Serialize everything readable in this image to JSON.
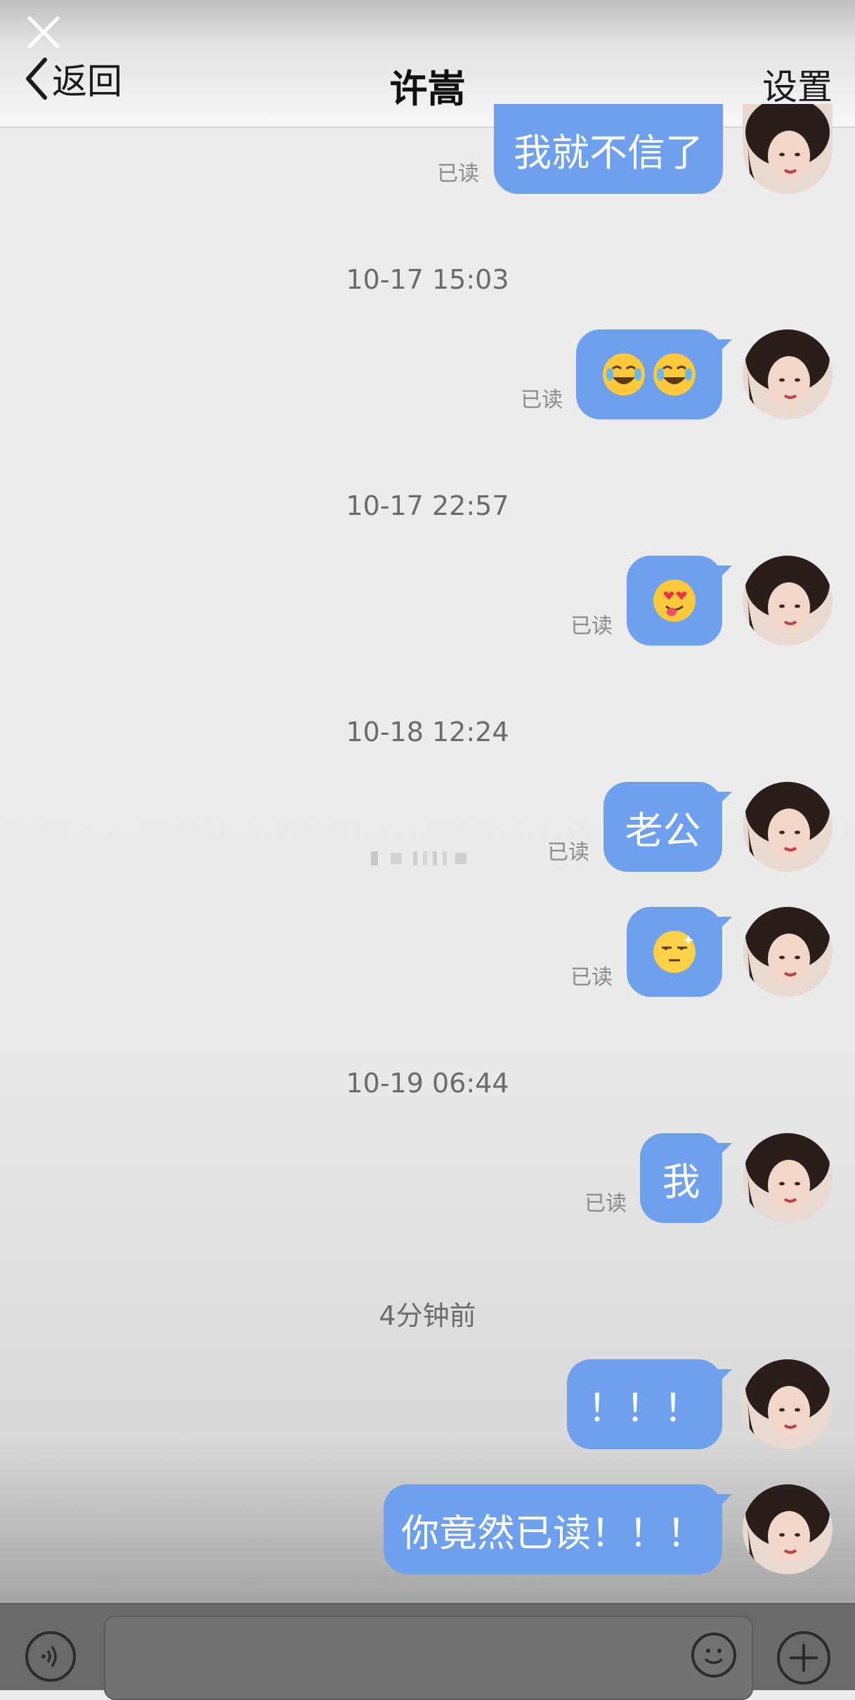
{
  "header": {
    "back_label": "返回",
    "title": "许嵩",
    "settings_label": "设置"
  },
  "read_label": "已读",
  "colors": {
    "bubble": "#6fa0ee",
    "background": "#ededed",
    "timestamp": "#6b6b6b"
  },
  "messages": [
    {
      "type": "text",
      "text": "我就不信了",
      "read": true
    },
    {
      "type": "timestamp",
      "text": "10-17 15:03"
    },
    {
      "type": "emoji",
      "icons": [
        "crying-laughing-face-icon",
        "crying-laughing-face-icon"
      ],
      "read": true
    },
    {
      "type": "timestamp",
      "text": "10-17 22:57"
    },
    {
      "type": "emoji",
      "icons": [
        "heart-eyes-tongue-face-icon"
      ],
      "read": true
    },
    {
      "type": "timestamp",
      "text": "10-18 12:24"
    },
    {
      "type": "text",
      "text": "老公",
      "read": true
    },
    {
      "type": "emoji",
      "icons": [
        "sly-sparkle-face-icon"
      ],
      "read": true
    },
    {
      "type": "timestamp",
      "text": "10-19 06:44"
    },
    {
      "type": "text",
      "text": "我",
      "read": true
    },
    {
      "type": "timestamp",
      "text": "4分钟前"
    },
    {
      "type": "text",
      "text": "！！！"
    },
    {
      "type": "text",
      "text": "你竟然已读！！！"
    }
  ],
  "input_bar": {
    "icons": [
      "voice-icon",
      "emoji-icon",
      "plus-icon"
    ]
  }
}
